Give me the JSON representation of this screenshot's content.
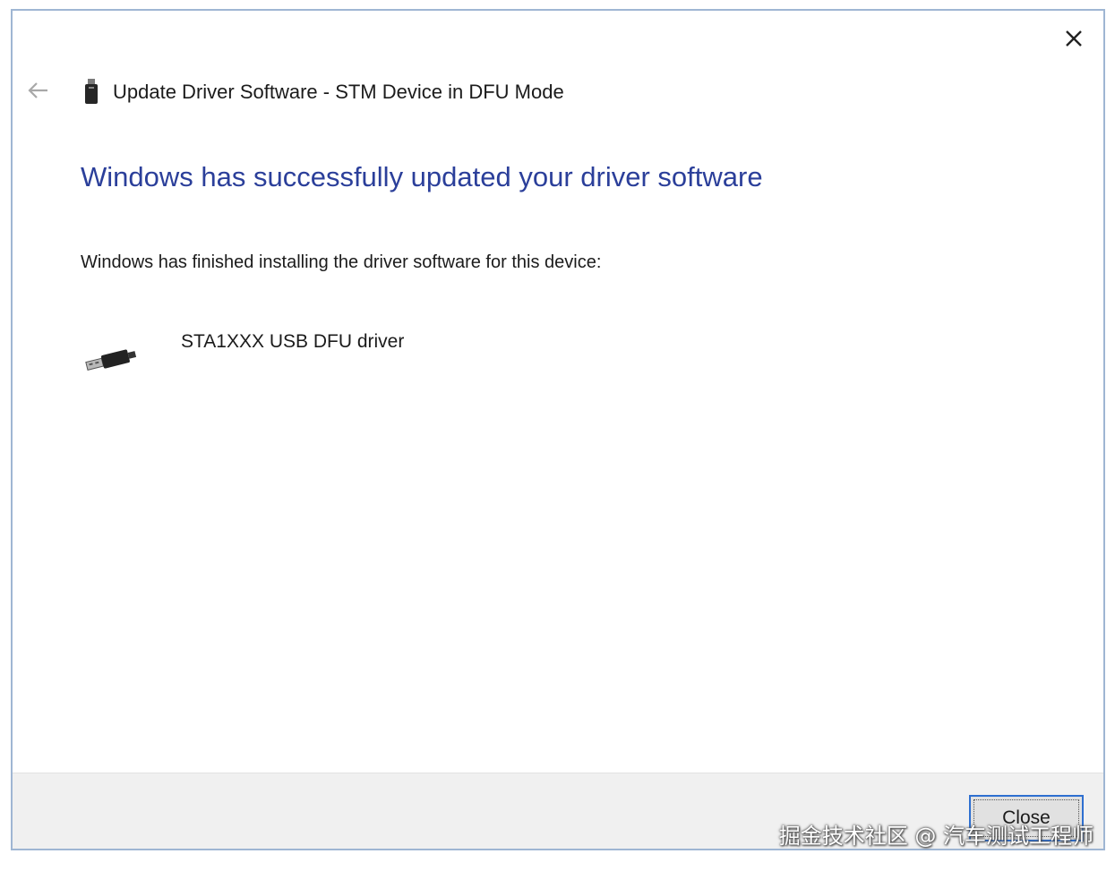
{
  "window": {
    "title": "Update Driver Software - STM Device in DFU Mode"
  },
  "icons": {
    "close": "close-icon",
    "back": "back-arrow-icon",
    "device": "usb-device-icon",
    "driver": "usb-plug-icon"
  },
  "content": {
    "heading": "Windows has successfully updated your driver software",
    "description": "Windows has finished installing the driver software for this device:",
    "driver_name": "STA1XXX USB DFU driver"
  },
  "footer": {
    "close_label": "Close"
  },
  "watermark": {
    "text": "掘金技术社区 @ 汽车测试工程师"
  },
  "colors": {
    "heading": "#2b3f9a",
    "button_focus": "#2e6fd0",
    "footer_bg": "#f0f0f0",
    "border": "#9fb6d3"
  }
}
